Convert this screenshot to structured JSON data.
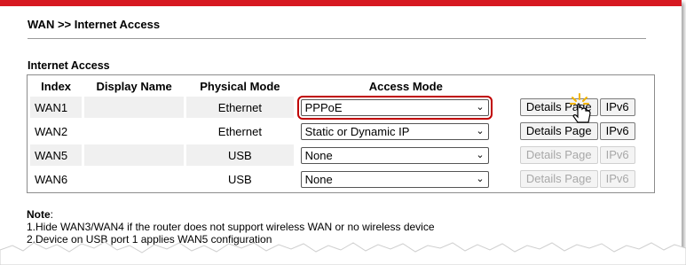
{
  "breadcrumb": "WAN >> Internet Access",
  "section_title": "Internet Access",
  "table": {
    "headers": [
      "Index",
      "Display Name",
      "Physical Mode",
      "Access Mode"
    ],
    "rows": [
      {
        "index": "WAN1",
        "display_name": "",
        "physical_mode": "Ethernet",
        "access_mode": "PPPoE",
        "details_label": "Details Page",
        "ipv6_label": "IPv6",
        "buttons_enabled": true,
        "highlighted": true
      },
      {
        "index": "WAN2",
        "display_name": "",
        "physical_mode": "Ethernet",
        "access_mode": "Static or Dynamic IP",
        "details_label": "Details Page",
        "ipv6_label": "IPv6",
        "buttons_enabled": true,
        "highlighted": false
      },
      {
        "index": "WAN5",
        "display_name": "",
        "physical_mode": "USB",
        "access_mode": "None",
        "details_label": "Details Page",
        "ipv6_label": "IPv6",
        "buttons_enabled": false,
        "highlighted": false
      },
      {
        "index": "WAN6",
        "display_name": "",
        "physical_mode": "USB",
        "access_mode": "None",
        "details_label": "Details Page",
        "ipv6_label": "IPv6",
        "buttons_enabled": false,
        "highlighted": false
      }
    ]
  },
  "note": {
    "title": "Note",
    "lines": [
      "1.Hide WAN3/WAN4 if the router does not support wireless WAN or no wireless device",
      "2.Device on USB port 1 applies WAN5 configuration"
    ]
  },
  "colors": {
    "brand_bar": "#d71921",
    "highlight": "#c00000",
    "row_shade": "#f0f0f0"
  },
  "icons": {
    "select_arrow": "chevron-down-icon",
    "pointer": "hand-pointer-icon"
  }
}
